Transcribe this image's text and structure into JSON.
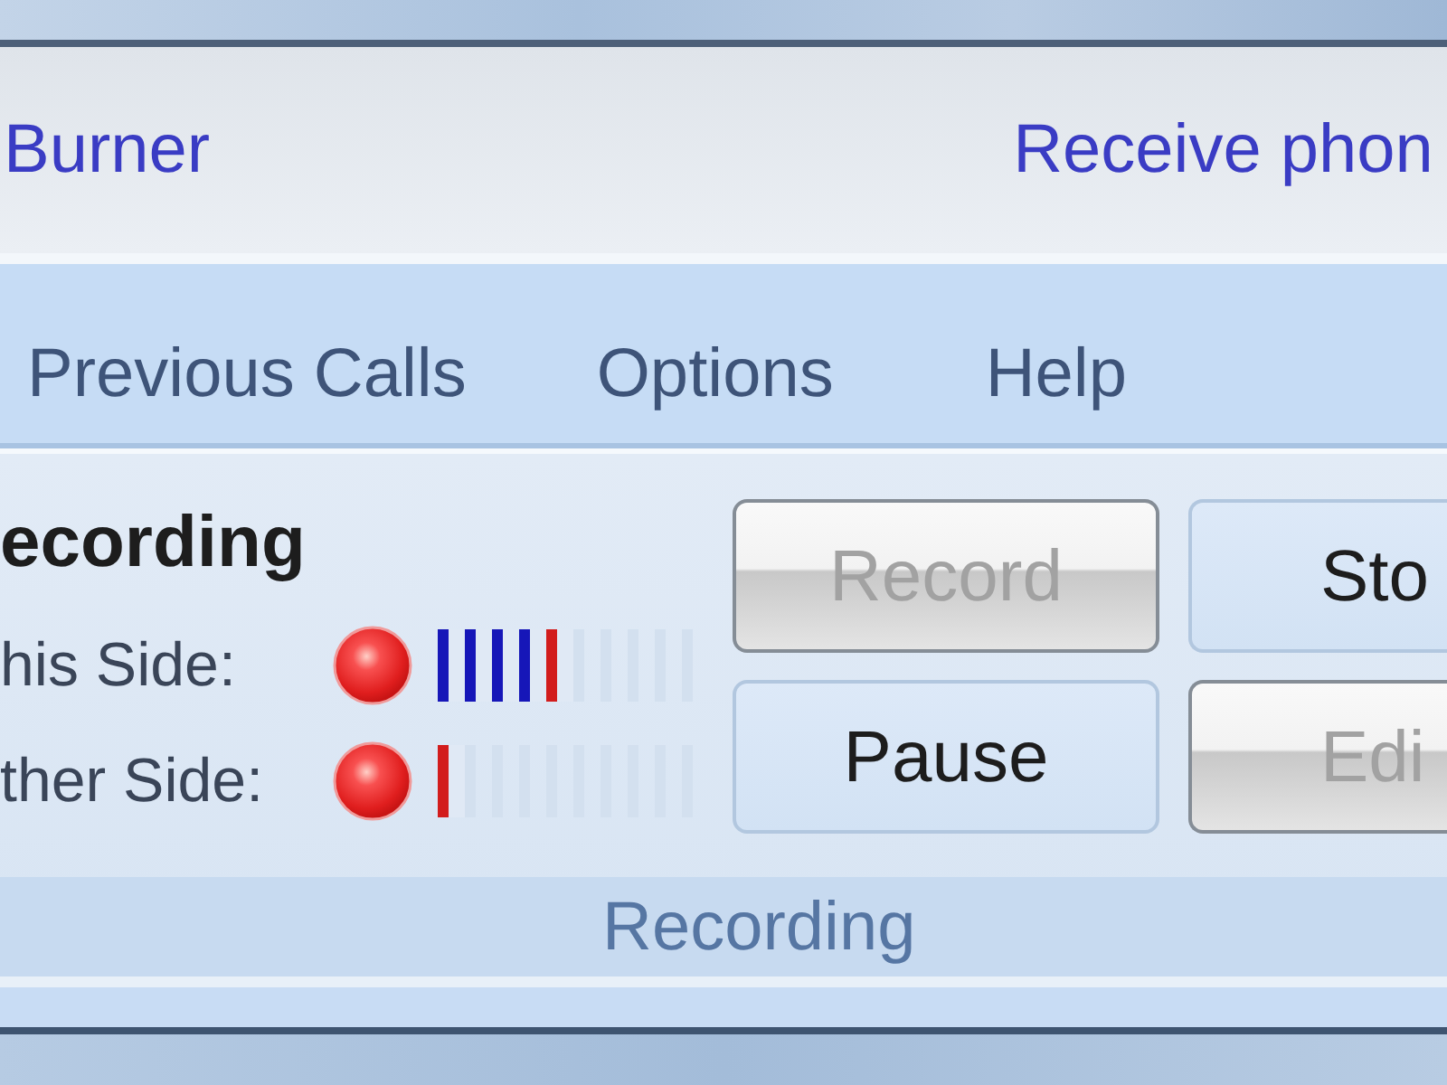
{
  "header": {
    "title": "Burner",
    "subtitle": "Receive phon"
  },
  "menu": [
    {
      "label": "Previous Calls"
    },
    {
      "label": "Options"
    },
    {
      "label": "Help"
    }
  ],
  "recording_group": {
    "heading": "ecording",
    "channels": [
      {
        "label": "his Side:",
        "level": 0.5
      },
      {
        "label": "ther Side:",
        "level": 0.1
      }
    ],
    "buttons": [
      {
        "label": "Record",
        "disabled": true
      },
      {
        "label": "Sto",
        "disabled": false
      },
      {
        "label": "Pause",
        "disabled": false
      },
      {
        "label": "Edi",
        "disabled": true
      }
    ],
    "group_label": "Recording"
  }
}
